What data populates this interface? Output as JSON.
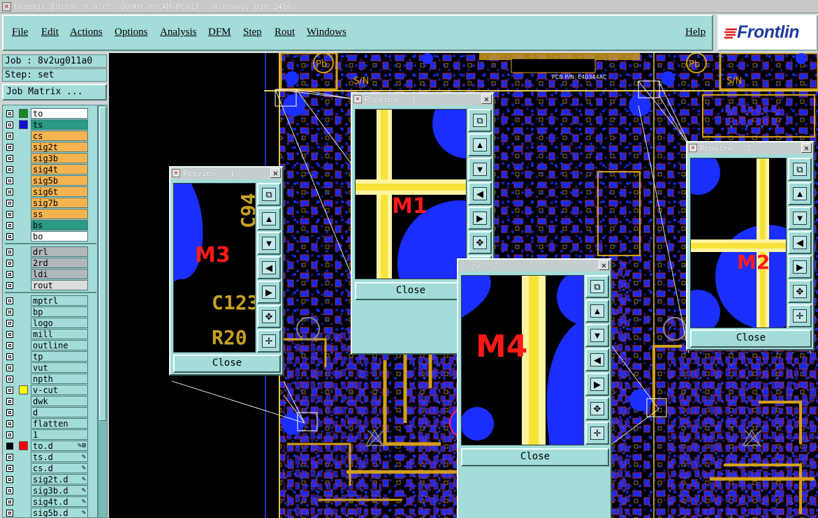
{
  "window": {
    "title": "Graphic Editor 9.02c2 (OO@HY-HYCAM-PC017 - Windows, pid:2416)"
  },
  "menu": {
    "items": [
      "File",
      "Edit",
      "Actions",
      "Options",
      "Analysis",
      "DFM",
      "Step",
      "Rout",
      "Windows"
    ],
    "help": "Help"
  },
  "logo": {
    "text": "Frontlin"
  },
  "job": {
    "label": "Job : 8v2ug011a0",
    "step": "Step: set",
    "matrix_button": "Job Matrix ..."
  },
  "layers": {
    "group1": [
      {
        "name": "to",
        "color": "#ffffff",
        "swatch": "#1a8a1a",
        "checked": false
      },
      {
        "name": "ts",
        "color": "#2a9a84",
        "swatch": "#1010d0",
        "checked": false
      },
      {
        "name": "cs",
        "color": "#f5b350",
        "checked": false
      },
      {
        "name": "sig2t",
        "color": "#f5b350",
        "checked": false
      },
      {
        "name": "sig3b",
        "color": "#f5b350",
        "checked": false
      },
      {
        "name": "sig4t",
        "color": "#f5b350",
        "checked": false
      },
      {
        "name": "sig5b",
        "color": "#f5b350",
        "checked": false
      },
      {
        "name": "sig6t",
        "color": "#f5b350",
        "checked": false
      },
      {
        "name": "sig7b",
        "color": "#f5b350",
        "checked": false
      },
      {
        "name": "ss",
        "color": "#f5b350",
        "checked": false
      },
      {
        "name": "bs",
        "color": "#2a9a84",
        "checked": false
      },
      {
        "name": "bo",
        "color": "#ffffff",
        "checked": false
      }
    ],
    "group2": [
      {
        "name": "drl",
        "color": "#b0b8bc",
        "checked": false
      },
      {
        "name": "2rd",
        "color": "#b0b8bc",
        "checked": false
      },
      {
        "name": "ldi",
        "color": "#b0b8bc",
        "checked": false
      },
      {
        "name": "rout",
        "color": "#dcdcdc",
        "checked": false
      }
    ],
    "group3": [
      {
        "name": "mptrl",
        "color": "#a3dcd8",
        "checked": false
      },
      {
        "name": "bp",
        "color": "#a3dcd8",
        "checked": false
      },
      {
        "name": "logo",
        "color": "#a3dcd8",
        "checked": false
      },
      {
        "name": "mill",
        "color": "#a3dcd8",
        "checked": false
      },
      {
        "name": "outline",
        "color": "#a3dcd8",
        "checked": false
      },
      {
        "name": "tp",
        "color": "#a3dcd8",
        "checked": false
      },
      {
        "name": "vut",
        "color": "#a3dcd8",
        "checked": false
      },
      {
        "name": "npth",
        "color": "#a3dcd8",
        "checked": false
      },
      {
        "name": "v-cut",
        "color": "#a3dcd8",
        "swatch": "#ffff00",
        "checked": false
      },
      {
        "name": "dwk",
        "color": "#a3dcd8",
        "checked": false
      },
      {
        "name": "d",
        "color": "#a3dcd8",
        "checked": false
      },
      {
        "name": "flatten",
        "color": "#a3dcd8",
        "checked": false
      },
      {
        "name": "1",
        "color": "#a3dcd8",
        "checked": false
      },
      {
        "name": "to.d",
        "color": "#a3dcd8",
        "swatch": "#ff0000",
        "checked": true,
        "mark": "✎⊞"
      },
      {
        "name": "ts.d",
        "color": "#a3dcd8",
        "checked": false,
        "mark": "✎"
      },
      {
        "name": "cs.d",
        "color": "#a3dcd8",
        "checked": false,
        "mark": "✎"
      },
      {
        "name": "sig2t.d",
        "color": "#a3dcd8",
        "checked": false,
        "mark": "✎"
      },
      {
        "name": "sig3b.d",
        "color": "#a3dcd8",
        "checked": false,
        "mark": "✎"
      },
      {
        "name": "sig4t.d",
        "color": "#a3dcd8",
        "checked": false,
        "mark": "✎"
      },
      {
        "name": "sig5b.d",
        "color": "#a3dcd8",
        "checked": false,
        "mark": "✎"
      }
    ]
  },
  "popups": {
    "p3": {
      "title": "Popview - 3",
      "mark": "M1",
      "close": "Close"
    },
    "p4": {
      "title": "Popview - 4",
      "mark": "M3",
      "close": "Close",
      "texts": [
        "C94",
        "C123",
        "R20"
      ]
    },
    "p1": {
      "title": "Popview - 1",
      "mark": "M2",
      "close": "Close"
    },
    "p2": {
      "title": "ew - 2",
      "mark": "M4",
      "close": "Close"
    }
  },
  "tools": {
    "buttons": [
      "zoom-fit",
      "pan-up",
      "pan-down",
      "pan-left",
      "pan-right",
      "zoom-in",
      "zoom-out"
    ]
  },
  "board": {
    "labels": [
      "S/N",
      "PCB P/N: E40344AC",
      "S/N"
    ],
    "accent": "#d4a017",
    "copper": "#1a2fff"
  }
}
